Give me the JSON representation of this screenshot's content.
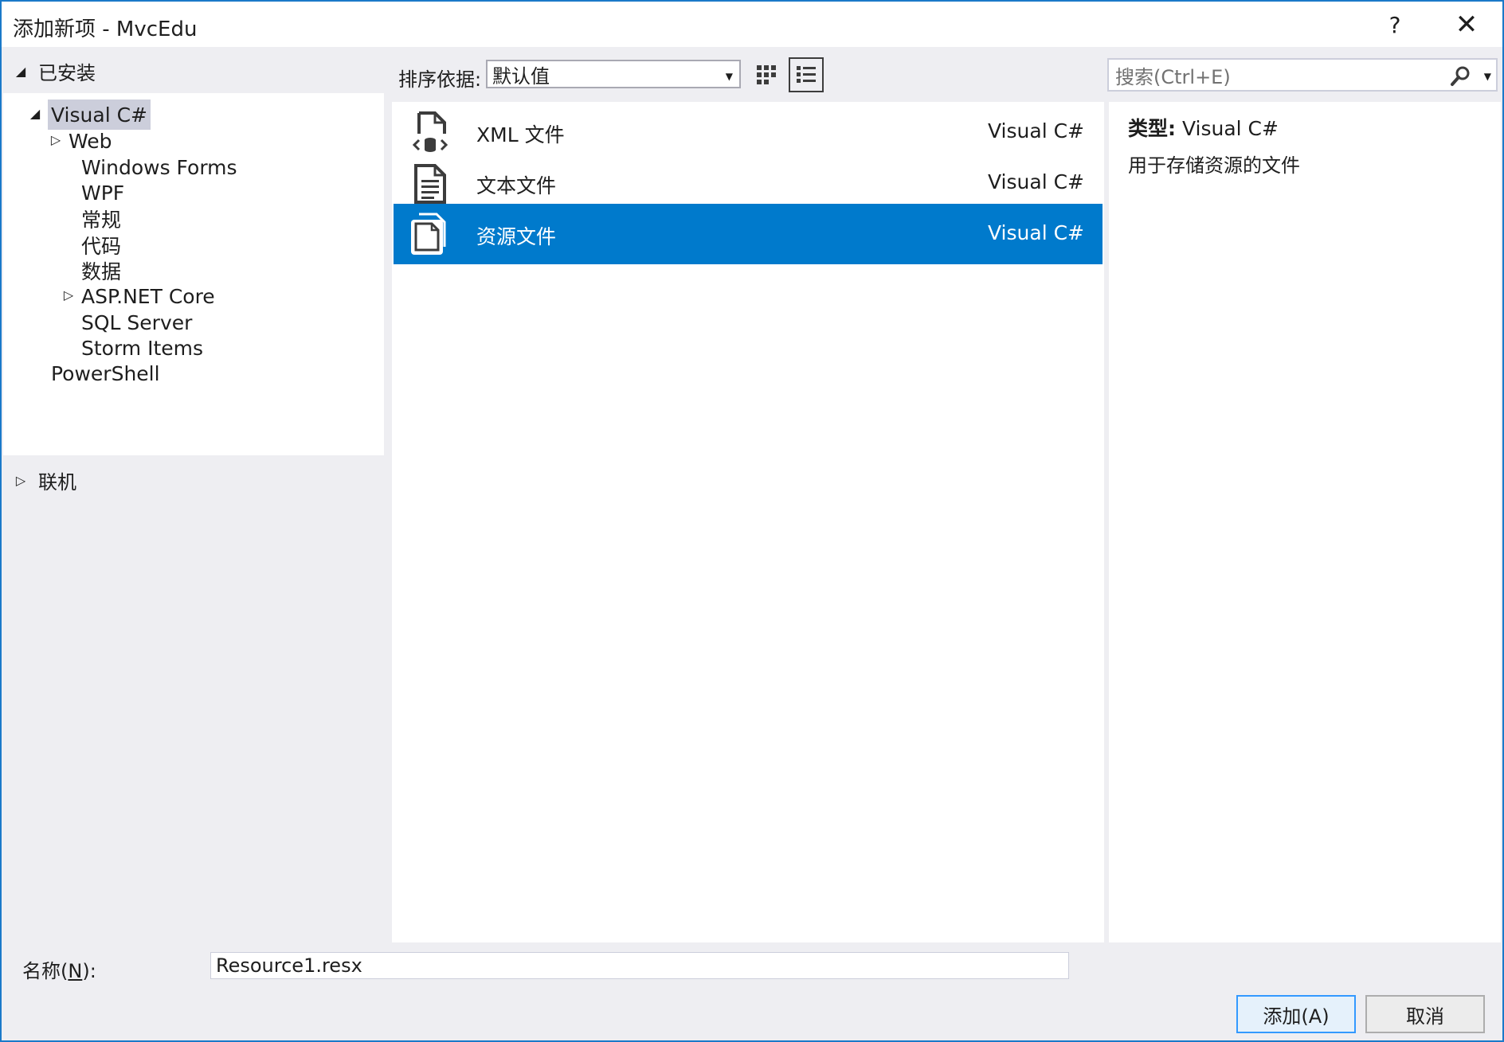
{
  "window": {
    "title": "添加新项 - MvcEdu",
    "help_label": "?",
    "close_label": "✕"
  },
  "left": {
    "installed_label": "已安装",
    "online_label": "联机",
    "tree": [
      {
        "label": "Visual C#",
        "expanded": true,
        "selected": true
      },
      {
        "label": "Web",
        "expandable": true
      },
      {
        "label": "Windows Forms"
      },
      {
        "label": "WPF"
      },
      {
        "label": "常规"
      },
      {
        "label": "代码"
      },
      {
        "label": "数据"
      },
      {
        "label": "ASP.NET Core",
        "expandable": true
      },
      {
        "label": "SQL Server"
      },
      {
        "label": "Storm Items"
      },
      {
        "label": "PowerShell"
      }
    ]
  },
  "toolbar": {
    "sort_label": "排序依据:",
    "sort_value": "默认值",
    "search_placeholder": "搜索(Ctrl+E)"
  },
  "items": [
    {
      "name": "XML 文件",
      "language": "Visual C#",
      "icon": "xml-file-icon"
    },
    {
      "name": "文本文件",
      "language": "Visual C#",
      "icon": "text-file-icon"
    },
    {
      "name": "资源文件",
      "language": "Visual C#",
      "icon": "resource-file-icon",
      "selected": true
    }
  ],
  "details": {
    "type_label": "类型:",
    "type_value": "Visual C#",
    "description": "用于存储资源的文件"
  },
  "bottom": {
    "name_label_prefix": "名称(",
    "name_label_key": "N",
    "name_label_suffix": "):",
    "name_value": "Resource1.resx",
    "add_label": "添加(A)",
    "cancel_label": "取消"
  },
  "colors": {
    "selection": "#007acc",
    "tree_selection": "#cccedb",
    "background": "#eeeef2",
    "border_accent": "#1a79c9"
  }
}
